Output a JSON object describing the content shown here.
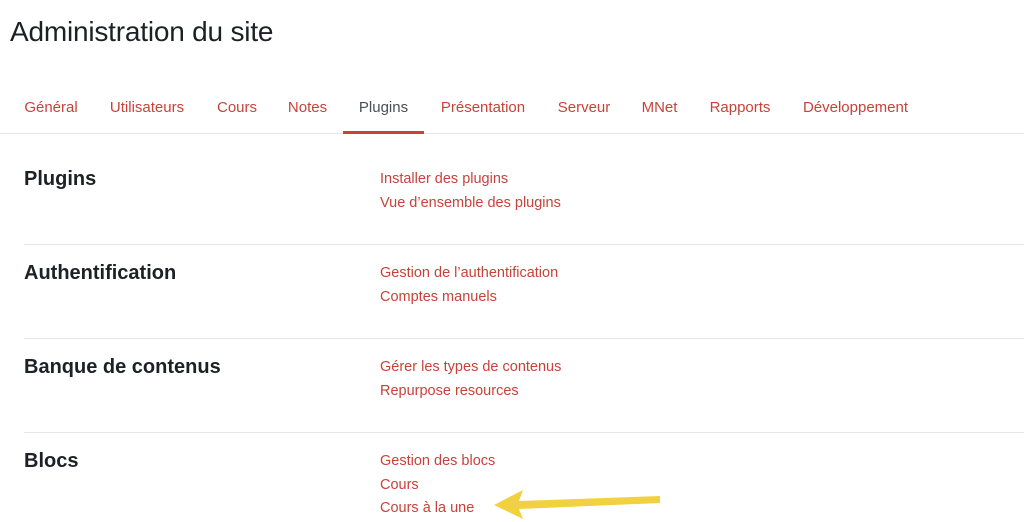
{
  "page": {
    "title": "Administration du site"
  },
  "tabs": [
    {
      "label": "Général",
      "active": false
    },
    {
      "label": "Utilisateurs",
      "active": false
    },
    {
      "label": "Cours",
      "active": false
    },
    {
      "label": "Notes",
      "active": false
    },
    {
      "label": "Plugins",
      "active": true
    },
    {
      "label": "Présentation",
      "active": false
    },
    {
      "label": "Serveur",
      "active": false
    },
    {
      "label": "MNet",
      "active": false
    },
    {
      "label": "Rapports",
      "active": false
    },
    {
      "label": "Développement",
      "active": false
    }
  ],
  "sections": [
    {
      "title": "Plugins",
      "links": [
        "Installer des plugins",
        "Vue d’ensemble des plugins"
      ]
    },
    {
      "title": "Authentification",
      "links": [
        "Gestion de l’authentification",
        "Comptes manuels"
      ]
    },
    {
      "title": "Banque de contenus",
      "links": [
        "Gérer les types de contenus",
        "Repurpose resources"
      ]
    },
    {
      "title": "Blocs",
      "links": [
        "Gestion des blocs",
        "Cours",
        "Cours à la une"
      ]
    }
  ],
  "annotation": {
    "icon": "arrow-left-icon",
    "color": "#f2d141",
    "points_to": "Cours à la une"
  },
  "colors": {
    "accent": "#c8423a",
    "text": "#1d2125",
    "active_tab_text": "#4a4f55",
    "divider": "#e6e6e6"
  }
}
